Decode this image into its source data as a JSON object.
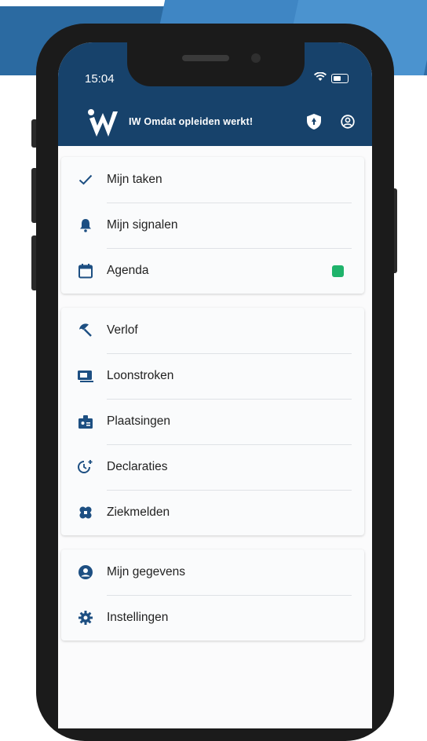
{
  "status_bar": {
    "time": "15:04"
  },
  "header": {
    "brand": "IW Omdat opleiden werkt!",
    "logo_icon": "iw-logo-icon",
    "actions": [
      {
        "name": "shield-icon"
      },
      {
        "name": "account-icon"
      }
    ]
  },
  "menu": {
    "section1": [
      {
        "label": "Mijn taken",
        "icon": "check-icon"
      },
      {
        "label": "Mijn signalen",
        "icon": "bell-icon"
      },
      {
        "label": "Agenda",
        "icon": "calendar-icon",
        "indicator_color": "#1fb36b"
      }
    ],
    "section2": [
      {
        "label": "Verlof",
        "icon": "umbrella-icon"
      },
      {
        "label": "Loonstroken",
        "icon": "payslip-icon"
      },
      {
        "label": "Plaatsingen",
        "icon": "badge-icon"
      },
      {
        "label": "Declaraties",
        "icon": "clock-plus-icon"
      },
      {
        "label": "Ziekmelden",
        "icon": "bandage-icon"
      }
    ],
    "section3": [
      {
        "label": "Mijn gegevens",
        "icon": "account-circle-icon"
      },
      {
        "label": "Instellingen",
        "icon": "gear-icon"
      }
    ]
  },
  "colors": {
    "header_bg": "#17426b",
    "icon_blue": "#1d4f82",
    "accent_green": "#1fb36b"
  }
}
